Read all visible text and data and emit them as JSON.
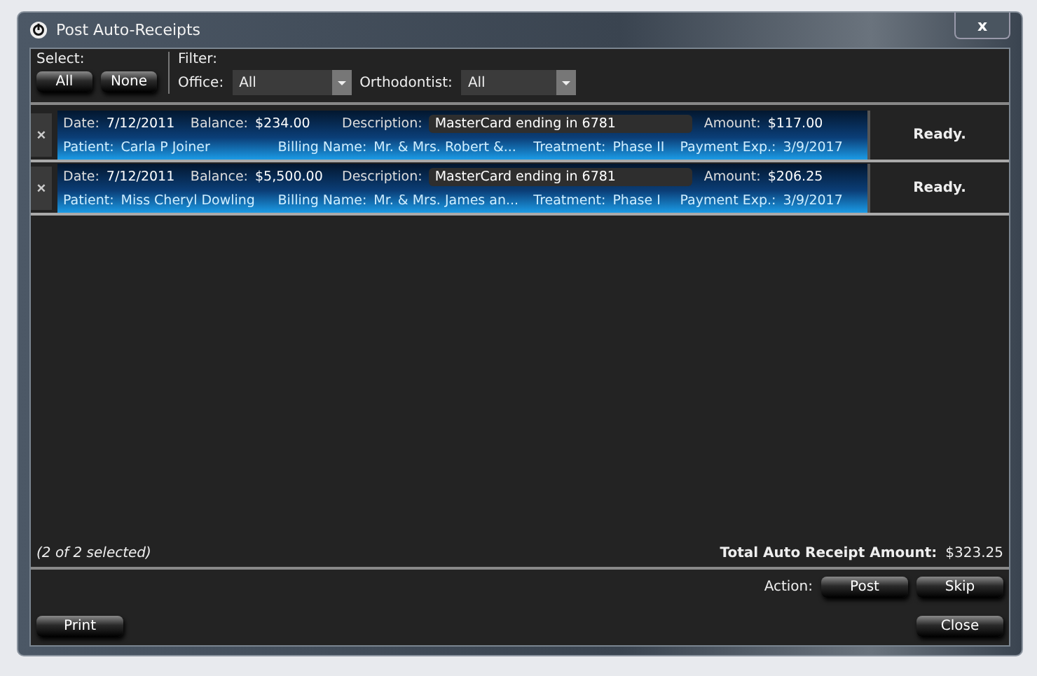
{
  "window": {
    "title": "Post Auto-Receipts",
    "close": "x"
  },
  "select": {
    "label": "Select:",
    "buttons": [
      "All",
      "None"
    ]
  },
  "filter": {
    "label": "Filter:",
    "fields": [
      {
        "label": "Office:",
        "value": "All"
      },
      {
        "label": "Orthodontist:",
        "value": "All"
      }
    ]
  },
  "receipts": [
    {
      "selected": true,
      "remove": "×",
      "date_label": "Date:",
      "date": "7/12/2011",
      "balance_label": "Balance:",
      "balance": "$234.00",
      "description_label": "Description:",
      "description": "MasterCard ending in 6781",
      "amount_label": "Amount:",
      "amount": "$117.00",
      "patient_label": "Patient:",
      "patient": "Carla P Joiner",
      "billing_label": "Billing Name:",
      "billing": "Mr. & Mrs. Robert &...",
      "treatment_label": "Treatment:",
      "treatment": "Phase II",
      "expiry_label": "Payment Exp.:",
      "expiry": "3/9/2017",
      "status": "Ready."
    },
    {
      "selected": true,
      "remove": "×",
      "date_label": "Date:",
      "date": "7/12/2011",
      "balance_label": "Balance:",
      "balance": "$5,500.00",
      "description_label": "Description:",
      "description": "MasterCard ending in 6781",
      "amount_label": "Amount:",
      "amount": "$206.25",
      "patient_label": "Patient:",
      "patient": "Miss Cheryl Dowling",
      "billing_label": "Billing Name:",
      "billing": "Mr. & Mrs. James an...",
      "treatment_label": "Treatment:",
      "treatment": "Phase I",
      "expiry_label": "Payment Exp.:",
      "expiry": "3/9/2017",
      "status": "Ready."
    }
  ],
  "summary": {
    "selection": "(2 of 2 selected)",
    "total_label": "Total Auto Receipt Amount:",
    "total": "$323.25"
  },
  "actions": {
    "label": "Action:",
    "buttons": [
      "Post",
      "Skip"
    ]
  },
  "footer": {
    "left_button": "Print",
    "right_button": "Close"
  }
}
